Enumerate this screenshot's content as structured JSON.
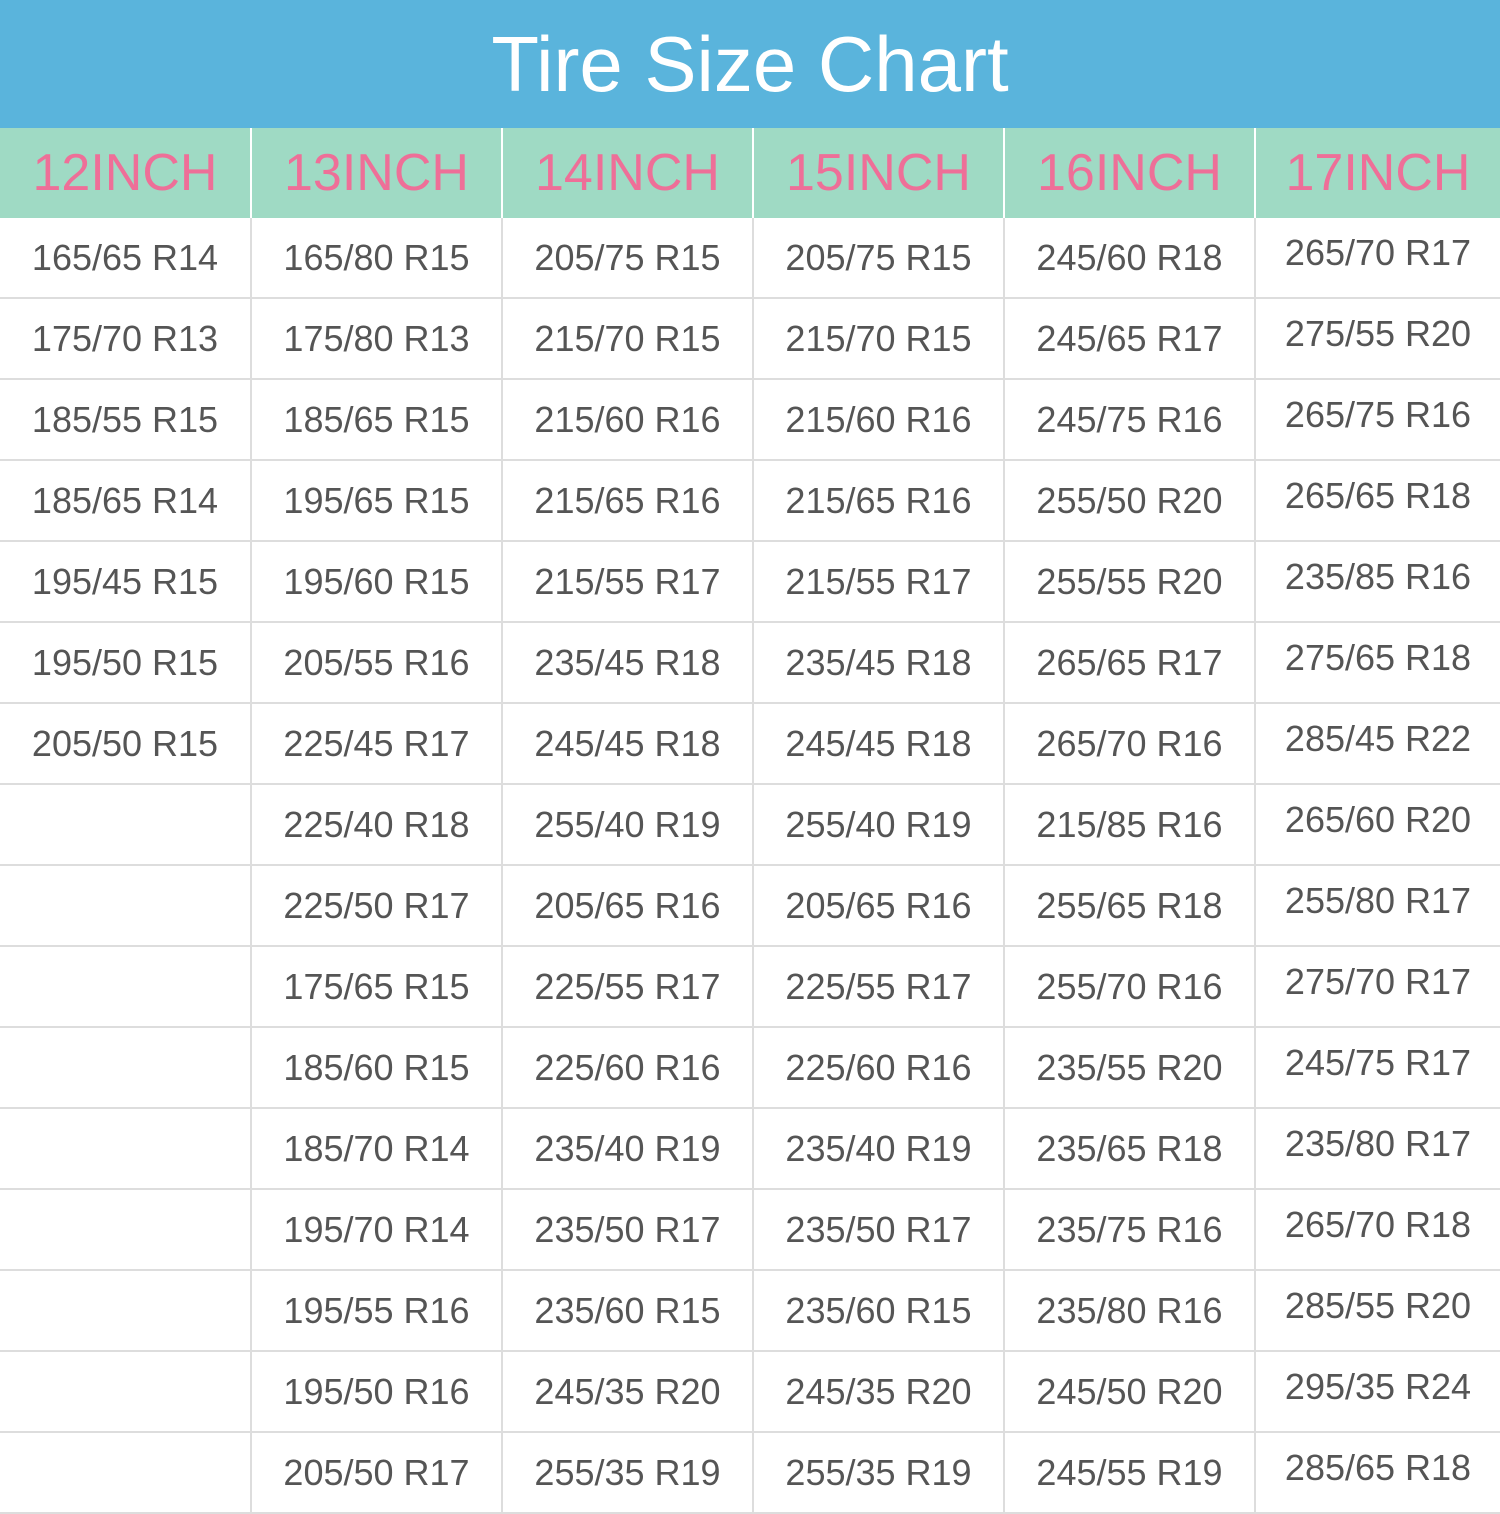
{
  "title": "Tire Size Chart",
  "colors": {
    "header_bg": "#5ab4dc",
    "column_header_bg": "#9fdac4",
    "column_header_text": "#ee6f98",
    "cell_text": "#555555",
    "grid_line": "#dddddd"
  },
  "columns": [
    "12INCH",
    "13INCH",
    "14INCH",
    "15INCH",
    "16INCH",
    "17INCH"
  ],
  "rows": [
    [
      "165/65 R14",
      "165/80 R15",
      "205/75 R15",
      "205/75 R15",
      "245/60 R18",
      "265/70 R17"
    ],
    [
      "175/70 R13",
      "175/80 R13",
      "215/70 R15",
      "215/70 R15",
      "245/65 R17",
      "275/55 R20"
    ],
    [
      "185/55 R15",
      "185/65 R15",
      "215/60 R16",
      "215/60 R16",
      "245/75 R16",
      "265/75 R16"
    ],
    [
      "185/65 R14",
      "195/65 R15",
      "215/65 R16",
      "215/65 R16",
      "255/50 R20",
      "265/65 R18"
    ],
    [
      "195/45 R15",
      "195/60 R15",
      "215/55 R17",
      "215/55 R17",
      "255/55 R20",
      "235/85 R16"
    ],
    [
      "195/50 R15",
      "205/55 R16",
      "235/45 R18",
      "235/45 R18",
      "265/65 R17",
      "275/65 R18"
    ],
    [
      "205/50 R15",
      "225/45 R17",
      "245/45 R18",
      "245/45 R18",
      "265/70 R16",
      "285/45 R22"
    ],
    [
      "",
      "225/40 R18",
      "255/40 R19",
      "255/40 R19",
      "215/85 R16",
      "265/60 R20"
    ],
    [
      "",
      "225/50 R17",
      "205/65 R16",
      "205/65 R16",
      "255/65 R18",
      "255/80 R17"
    ],
    [
      "",
      "175/65 R15",
      "225/55 R17",
      "225/55 R17",
      "255/70 R16",
      "275/70 R17"
    ],
    [
      "",
      "185/60 R15",
      "225/60 R16",
      "225/60 R16",
      "235/55 R20",
      "245/75 R17"
    ],
    [
      "",
      "185/70 R14",
      "235/40 R19",
      "235/40 R19",
      "235/65 R18",
      "235/80 R17"
    ],
    [
      "",
      "195/70 R14",
      "235/50 R17",
      "235/50 R17",
      "235/75 R16",
      "265/70 R18"
    ],
    [
      "",
      "195/55 R16",
      "235/60 R15",
      "235/60 R15",
      "235/80 R16",
      "285/55 R20"
    ],
    [
      "",
      "195/50 R16",
      "245/35 R20",
      "245/35 R20",
      "245/50 R20",
      "295/35 R24"
    ],
    [
      "",
      "205/50 R17",
      "255/35 R19",
      "255/35 R19",
      "245/55 R19",
      "285/65 R18"
    ]
  ]
}
